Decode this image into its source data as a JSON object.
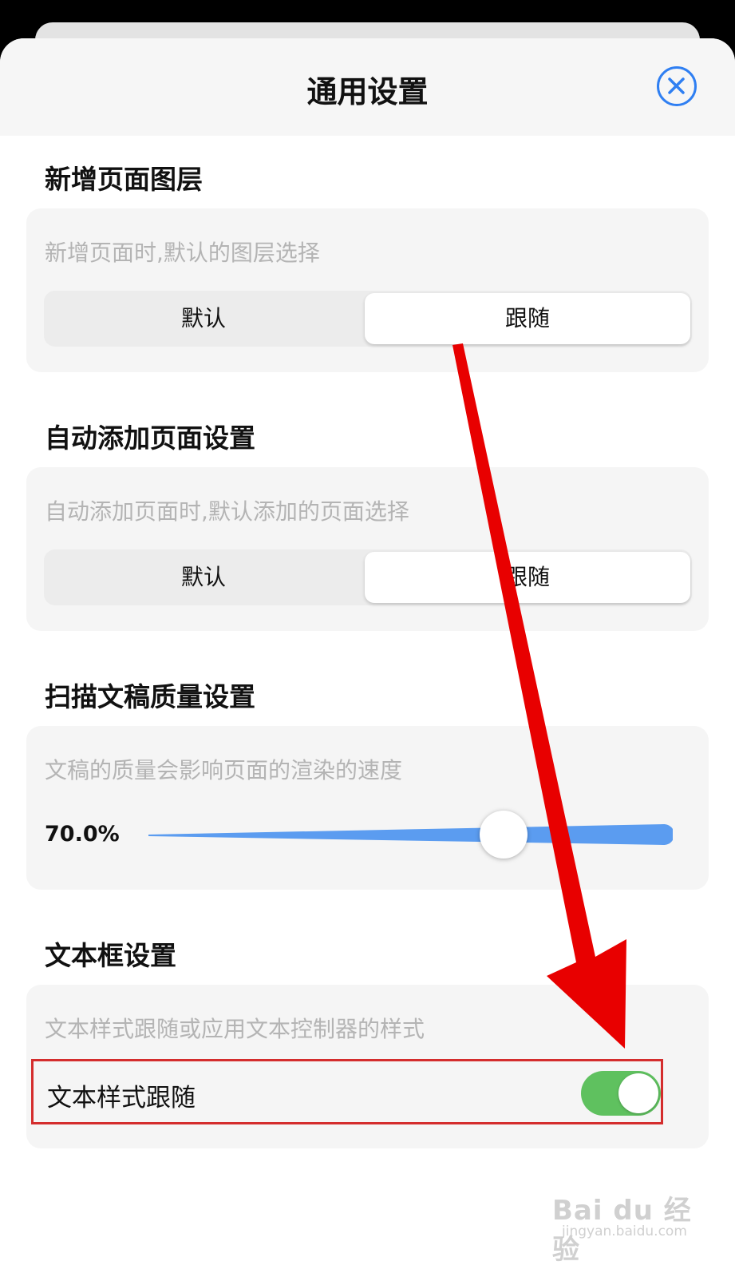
{
  "sheet": {
    "title": "通用设置",
    "close_icon": "close-circle-icon",
    "accent_color": "#2f7ff2"
  },
  "sections": {
    "new_page_layer": {
      "heading": "新增页面图层",
      "description": "新增页面时,默认的图层选择",
      "options": [
        "默认",
        "跟随"
      ],
      "selected": "跟随"
    },
    "auto_add_page": {
      "heading": "自动添加页面设置",
      "description": "自动添加页面时,默认添加的页面选择",
      "options": [
        "默认",
        "跟随"
      ],
      "selected": "跟随"
    },
    "scan_quality": {
      "heading": "扫描文稿质量设置",
      "description": "文稿的质量会影响页面的渲染的速度",
      "value_label": "70.0%",
      "value": 0.7,
      "track_color": "#5b9cf0"
    },
    "text_box": {
      "heading": "文本框设置",
      "description": "文本样式跟随或应用文本控制器的样式",
      "toggle_label": "文本样式跟随",
      "toggle_on": true,
      "toggle_color": "#5fc15f"
    }
  },
  "annotation": {
    "arrow_color": "#e80000",
    "highlight_color": "#d42d2d"
  },
  "watermark": {
    "text": "Bai du 经验",
    "subtext": "jingyan.baidu.com"
  }
}
